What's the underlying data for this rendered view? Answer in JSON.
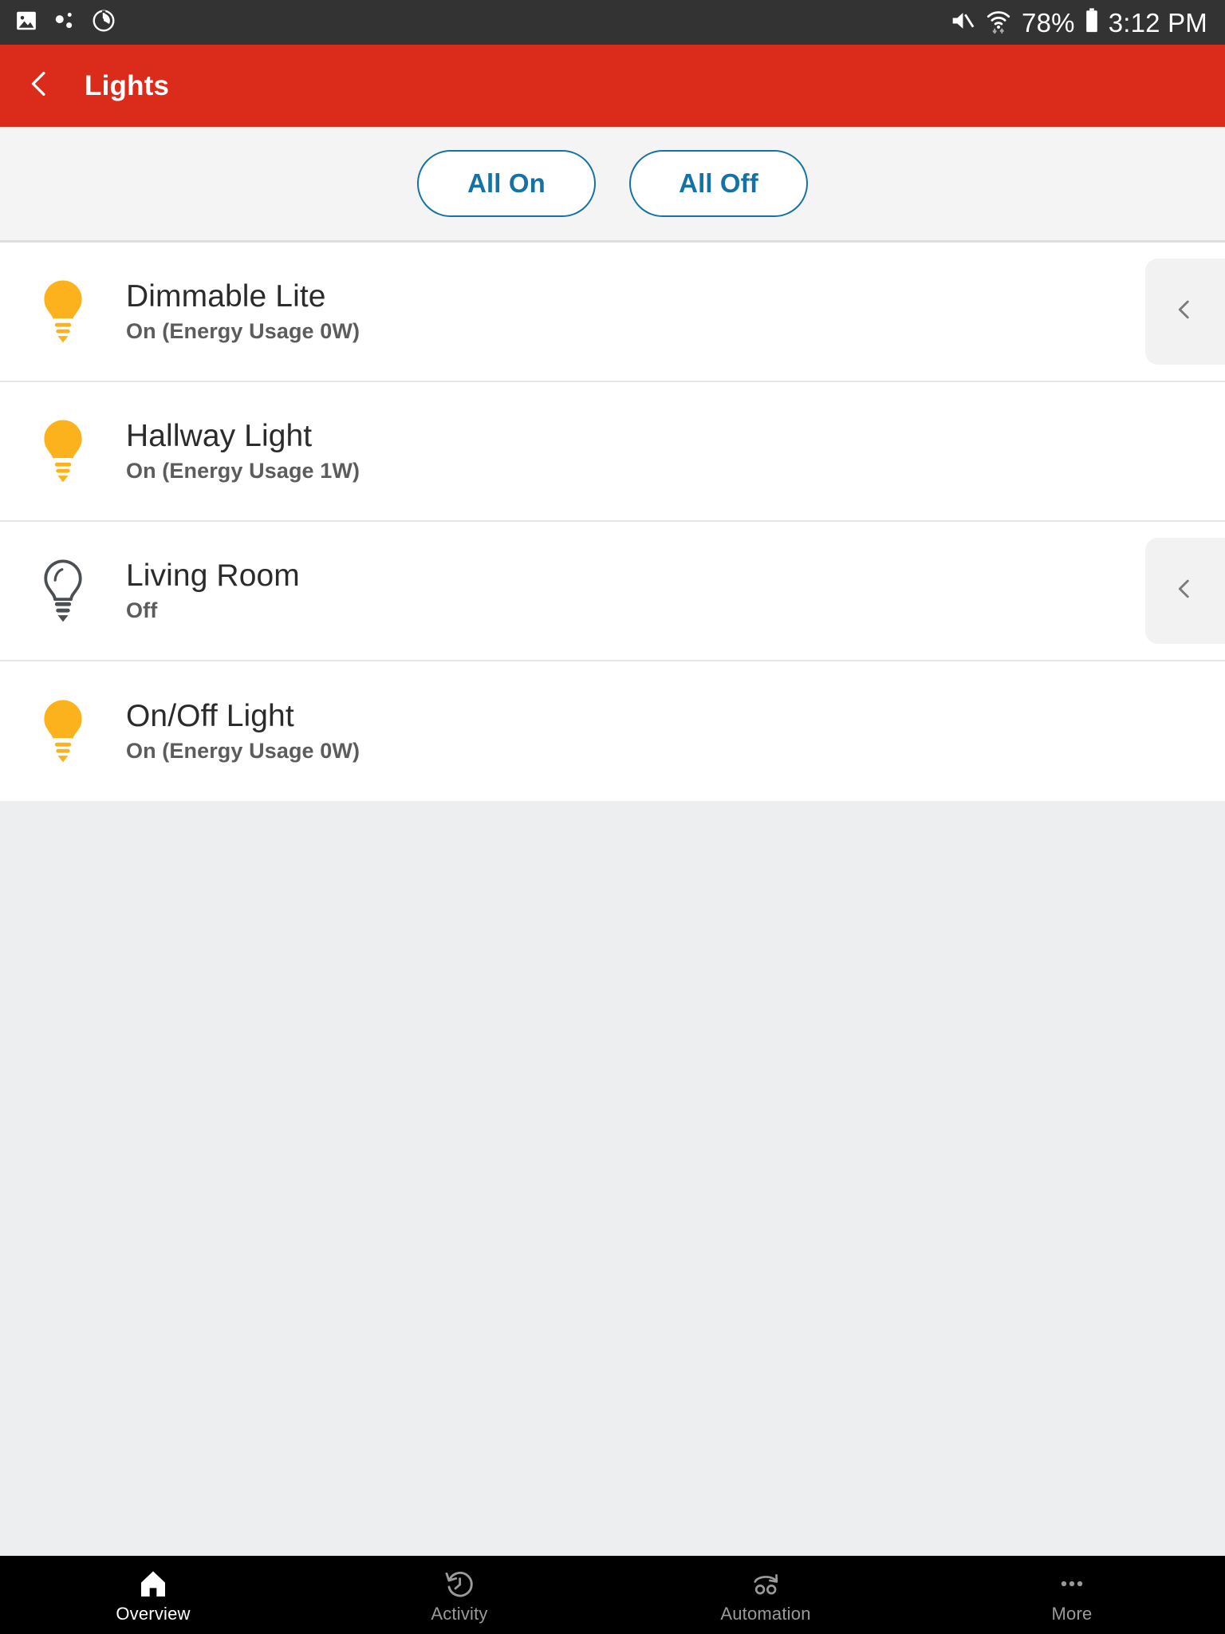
{
  "status_bar": {
    "left_icons": [
      {
        "name": "screenshot-icon"
      },
      {
        "name": "bluetooth-dots-icon"
      },
      {
        "name": "power-timer-icon"
      }
    ],
    "mute_icon": "volume-muted-icon",
    "wifi_icon": "wifi-icon",
    "battery_percent": "78%",
    "battery_icon": "battery-icon",
    "time": "3:12 PM",
    "background": "#333333",
    "foreground": "#FFFFFF"
  },
  "header": {
    "back_icon": "back-chevron-icon",
    "title": "Lights",
    "background": "#DB2B1B",
    "foreground": "#FFFFFF"
  },
  "bulk_actions": {
    "all_on_label": "All On",
    "all_off_label": "All Off",
    "accent": "#1572A5"
  },
  "devices": [
    {
      "name": "Dimmable Lite",
      "status": "On (Energy Usage 0W)",
      "state": "on",
      "icon": "lightbulb-on-icon",
      "icon_color": "#FBB21C",
      "has_reveal": true,
      "reveal_icon": "left-chevron-icon"
    },
    {
      "name": "Hallway Light",
      "status": "On (Energy Usage 1W)",
      "state": "on",
      "icon": "lightbulb-on-icon",
      "icon_color": "#FBB21C",
      "has_reveal": false,
      "reveal_icon": ""
    },
    {
      "name": "Living Room",
      "status": "Off",
      "state": "off",
      "icon": "lightbulb-off-icon",
      "icon_color": "#4A4F54",
      "has_reveal": true,
      "reveal_icon": "left-chevron-icon"
    },
    {
      "name": "On/Off Light",
      "status": "On (Energy Usage 0W)",
      "state": "on",
      "icon": "lightbulb-on-icon",
      "icon_color": "#FBB21C",
      "has_reveal": false,
      "reveal_icon": ""
    }
  ],
  "bottom_nav": {
    "items": [
      {
        "label": "Overview",
        "icon": "home-icon",
        "active": true
      },
      {
        "label": "Activity",
        "icon": "history-icon",
        "active": false
      },
      {
        "label": "Automation",
        "icon": "automation-icon",
        "active": false
      },
      {
        "label": "More",
        "icon": "ellipsis-icon",
        "active": false
      }
    ],
    "background": "#000000",
    "active_color": "#FFFFFF",
    "inactive_color": "#9A9A9A"
  }
}
